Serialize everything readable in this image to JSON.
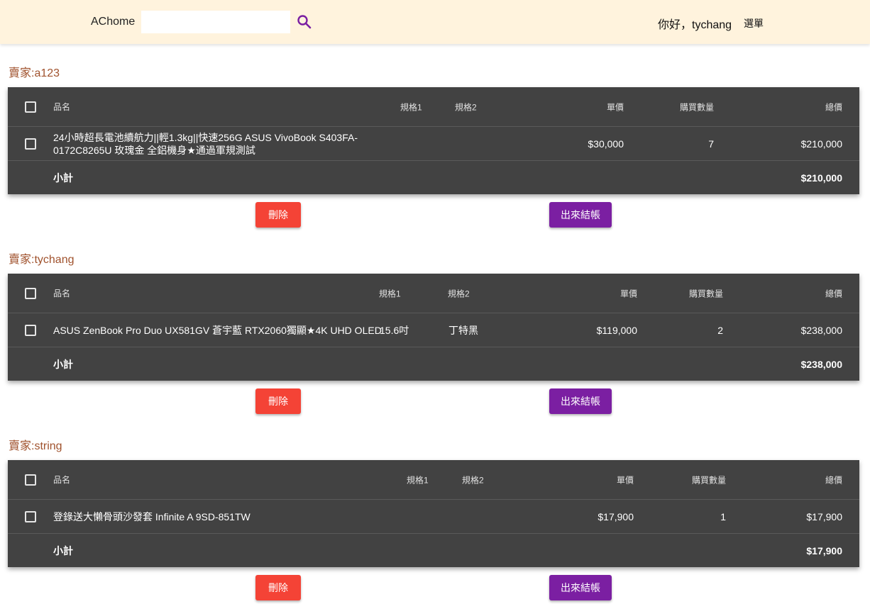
{
  "header": {
    "brand": "AChome",
    "search_placeholder": "",
    "search_icon": "search-icon",
    "greeting": "你好，tychang",
    "menu_label": "選單"
  },
  "colors": {
    "topbar": "#fff3dd",
    "table_bg": "#424242",
    "delete_button": "#f44336",
    "checkout_button": "#7b1fa2",
    "seller_label": "#a0522d",
    "search_icon": "#7b1fa2"
  },
  "carts": [
    {
      "seller": "賣家:a123",
      "columns": {
        "name": "品名",
        "spec1": "規格1",
        "spec2": "規格2",
        "price": "單價",
        "qty": "購買數量",
        "total": "總價"
      },
      "items": [
        {
          "name": "24小時超長電池續航力||輕1.3kg||快速256G ASUS VivoBook S403FA-0172C8265U 玫瑰金 全鋁機身★通過軍規測試",
          "spec1": "",
          "spec2": "",
          "price": "$30,000",
          "qty": "7",
          "total": "$210,000"
        }
      ],
      "subtotal_label": "小計",
      "subtotal": "$210,000",
      "delete_label": "刪除",
      "checkout_label": "出來結帳"
    },
    {
      "seller": "賣家:tychang",
      "columns": {
        "name": "品名",
        "spec1": "規格1",
        "spec2": "規格2",
        "price": "單價",
        "qty": "購買數量",
        "total": "總價"
      },
      "items": [
        {
          "name": "ASUS ZenBook Pro Duo UX581GV 蒼宇藍 RTX2060獨顯★4K UHD OLED",
          "spec1": "15.6吋",
          "spec2": "丁特黑",
          "price": "$119,000",
          "qty": "2",
          "total": "$238,000"
        }
      ],
      "subtotal_label": "小計",
      "subtotal": "$238,000",
      "delete_label": "刪除",
      "checkout_label": "出來結帳"
    },
    {
      "seller": "賣家:string",
      "columns": {
        "name": "品名",
        "spec1": "規格1",
        "spec2": "規格2",
        "price": "單價",
        "qty": "購買數量",
        "total": "總價"
      },
      "items": [
        {
          "name": "登錄送大懶骨頭沙發套 Infinite A 9SD-851TW",
          "spec1": "",
          "spec2": "",
          "price": "$17,900",
          "qty": "1",
          "total": "$17,900"
        }
      ],
      "subtotal_label": "小計",
      "subtotal": "$17,900",
      "delete_label": "刪除",
      "checkout_label": "出來結帳"
    }
  ]
}
